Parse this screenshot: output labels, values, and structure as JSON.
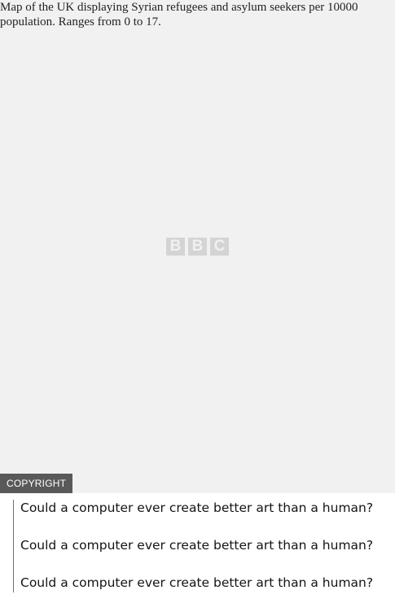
{
  "image": {
    "alt_text": "Map of the UK displaying Syrian refugees and asylum seekers per 10000 population. Ranges from 0 to 17.",
    "placeholder_logo": [
      "B",
      "B",
      "C"
    ],
    "copyright_label": "COPYRIGHT"
  },
  "related": {
    "items": [
      {
        "label": "Could a computer ever create better art than a human?"
      },
      {
        "label": "Could a computer ever create better art than a human?"
      },
      {
        "label": "Could a computer ever create better art than a human?"
      }
    ]
  },
  "colors": {
    "placeholder_bg": "#f1f1f1",
    "logo_block": "#d4d4d4",
    "badge_bg": "#595959",
    "divider": "#6e6e6e"
  }
}
